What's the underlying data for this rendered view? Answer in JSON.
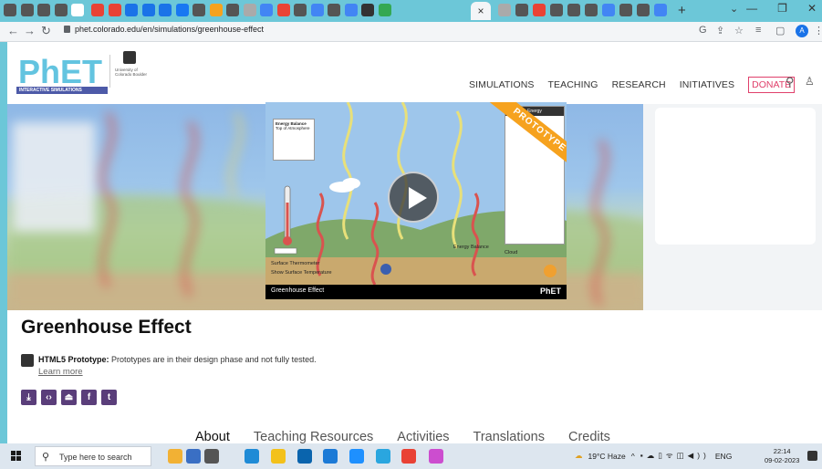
{
  "browser": {
    "url": "phet.colorado.edu/en/simulations/greenhouse-effect",
    "active_tab_close": "×",
    "new_tab": "+",
    "profile_initial": "A"
  },
  "site": {
    "logo_text": "PhET",
    "logo_subtext": "INTERACTIVE SIMULATIONS",
    "university": "University of Colorado Boulder",
    "nav": [
      "SIMULATIONS",
      "TEACHING",
      "RESEARCH",
      "INITIATIVES"
    ],
    "donate": "DONATE"
  },
  "sim_preview": {
    "ribbon": "PROTOTYPE",
    "energy_balance_title": "Energy Balance",
    "energy_balance_sub": "Top of Atmosphere",
    "bar_title": "Greenhouse Effect",
    "bar_brand": "PhET",
    "surface_thermometer": "Surface Thermometer",
    "surface_temperature": "Show Surface Temperature",
    "energy_balance_cb": "Energy Balance",
    "cloud_cb": "Cloud",
    "energy_panel": "Energy"
  },
  "content": {
    "title": "Greenhouse Effect",
    "prototype_label": "HTML5 Prototype:",
    "prototype_note": " Prototypes are in their design phase and not fully tested.",
    "learn_more": "Learn more",
    "tabs": [
      "About",
      "Teaching Resources",
      "Activities",
      "Translations",
      "Credits"
    ],
    "active_tab": "About"
  },
  "taskbar": {
    "search_placeholder": "Type here to search",
    "weather": "19°C  Haze",
    "language": "ENG",
    "time": "22:14",
    "date": "09-02-2023"
  },
  "colors": {
    "brand_purple": "#5a3e7a",
    "donate_pink": "#e0406b",
    "prototype_orange": "#f6a21e",
    "chrome_teal": "#6cc7d8"
  }
}
